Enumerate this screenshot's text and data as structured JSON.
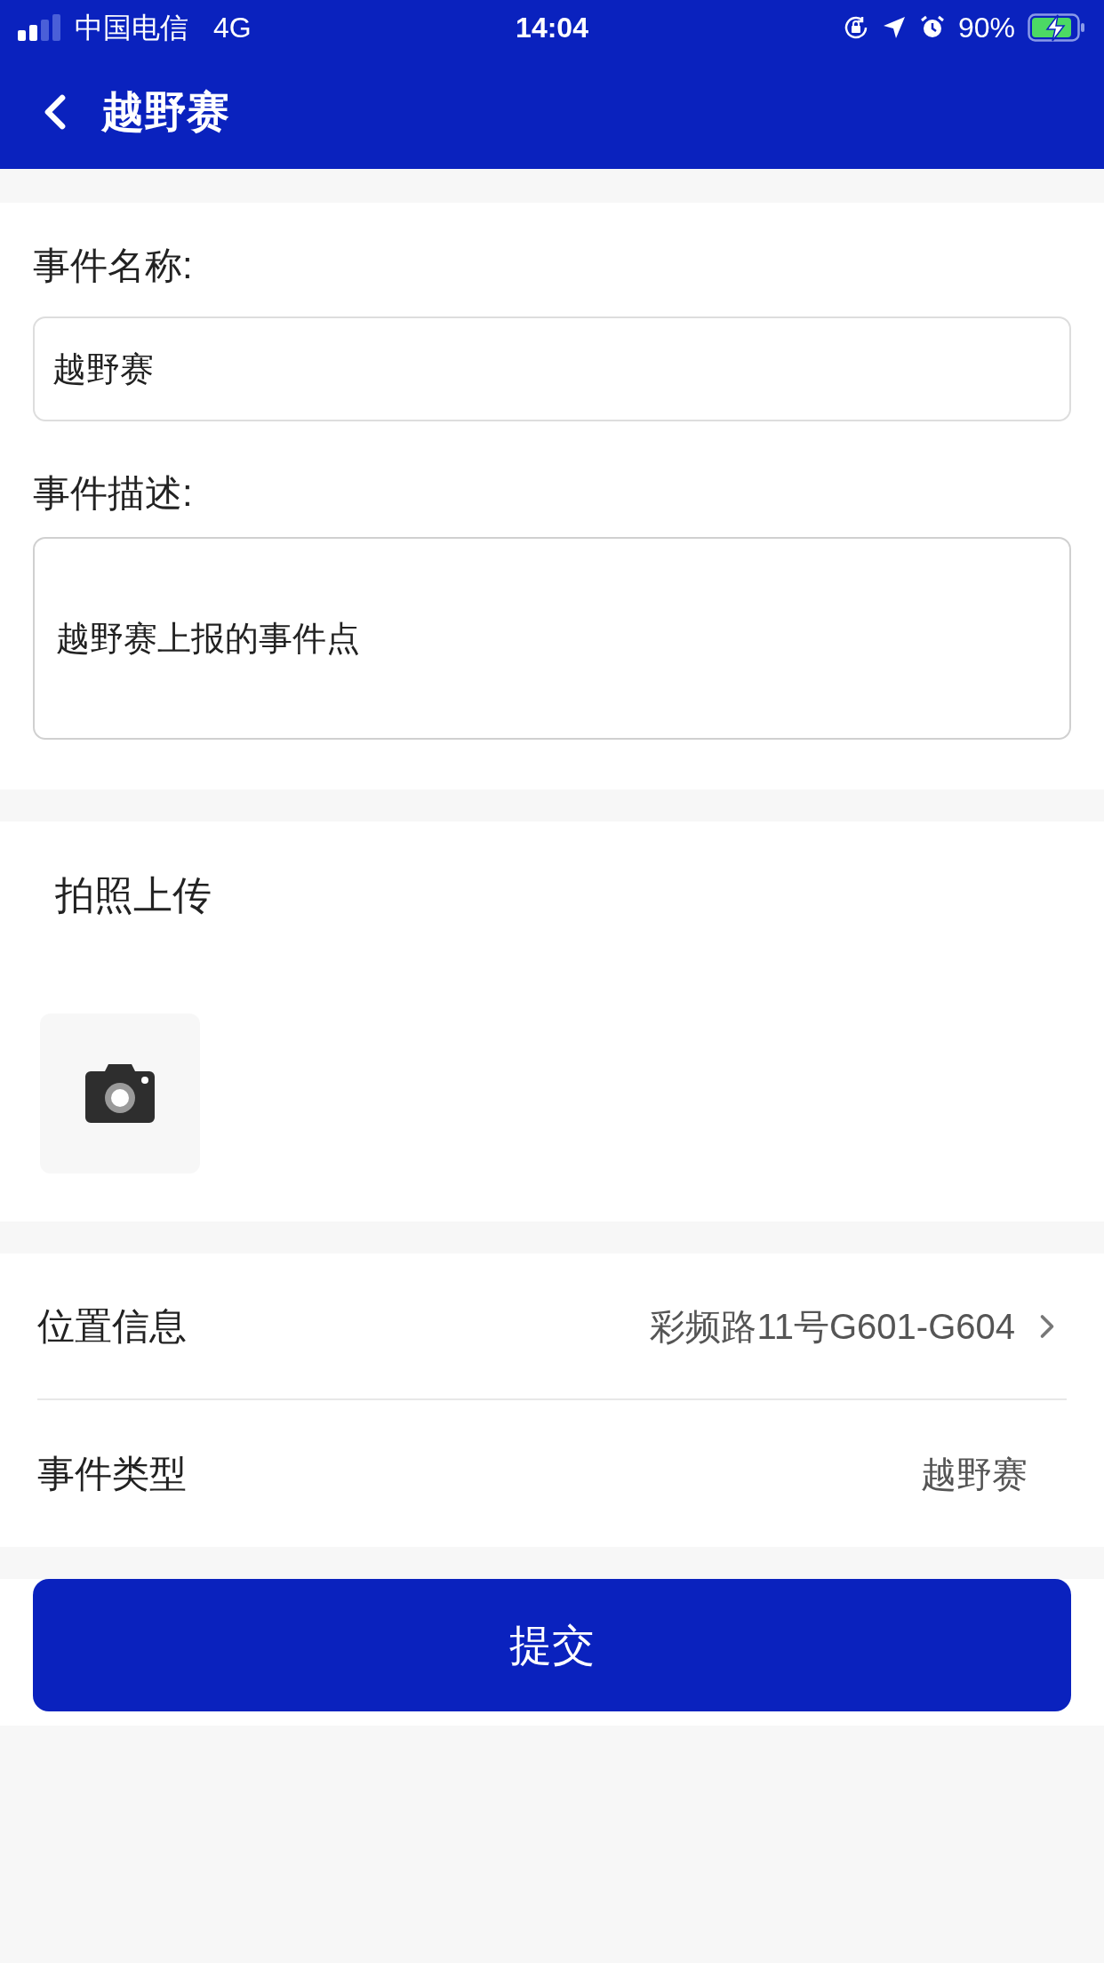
{
  "status_bar": {
    "carrier": "中国电信",
    "network": "4G",
    "time": "14:04",
    "battery": "90%",
    "charging": true
  },
  "nav": {
    "title": "越野赛"
  },
  "form": {
    "name_label": "事件名称:",
    "name_value": "越野赛",
    "desc_label": "事件描述:",
    "desc_value": "越野赛上报的事件点"
  },
  "photo": {
    "label": "拍照上传"
  },
  "info_rows": [
    {
      "label": "位置信息",
      "value": "彩频路11号G601-G604",
      "has_arrow": true
    },
    {
      "label": "事件类型",
      "value": "越野赛",
      "has_arrow": false
    }
  ],
  "submit": {
    "label": "提交"
  }
}
